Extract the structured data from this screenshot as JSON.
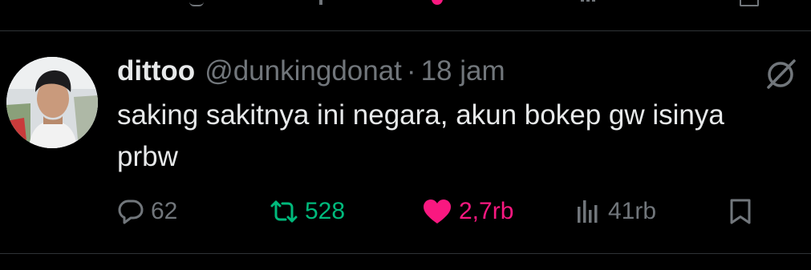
{
  "tweet": {
    "name": "dittoo",
    "handle": "@dunkingdonat",
    "separator": "·",
    "time": "18 jam",
    "text": "saking sakitnya ini negara, akun bokep gw isinya\nprbw"
  },
  "actions": {
    "replies": "62",
    "retweets": "528",
    "likes": "2,7rb",
    "views": "41rb"
  },
  "icons": {
    "reply": "reply-icon",
    "retweet": "retweet-icon",
    "like": "heart-icon",
    "views": "views-icon",
    "bookmark": "bookmark-icon",
    "grok": "grok-icon"
  },
  "colors": {
    "background": "#000000",
    "text": "#e7e9ea",
    "muted": "#71767b",
    "retweet": "#00ba7c",
    "like": "#f91880",
    "divider": "#2f3336"
  }
}
